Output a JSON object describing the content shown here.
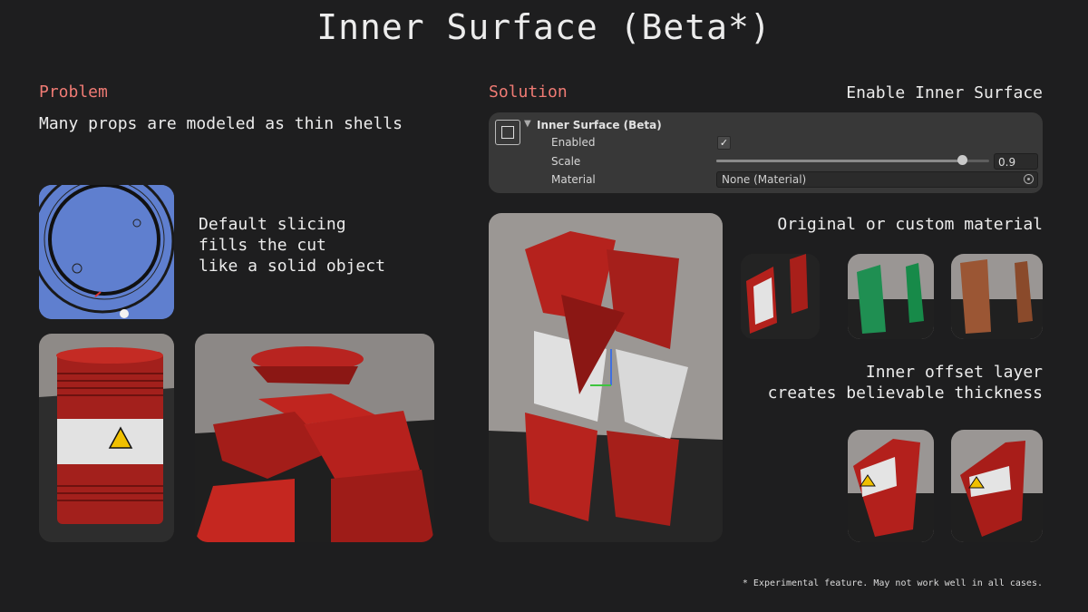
{
  "title": "Inner Surface (Beta*)",
  "problem": {
    "label": "Problem",
    "subtitle": "Many props are modeled as thin shells",
    "default_slicing": "Default slicing\nfills the cut\nlike a solid object"
  },
  "solution": {
    "label": "Solution",
    "enable_caption": "Enable Inner Surface",
    "material_caption": "Original or custom material",
    "offset_caption": "Inner offset layer\ncreates believable thickness"
  },
  "inspector": {
    "header": "Inner Surface (Beta)",
    "enabled_label": "Enabled",
    "enabled_check": "✓",
    "enabled": true,
    "scale_label": "Scale",
    "scale_value": "0.9",
    "scale_fraction": 0.9,
    "material_label": "Material",
    "material_value": "None (Material)"
  },
  "footnote": "* Experimental feature. May not work well in all cases.",
  "colors": {
    "accent": "#f07b74",
    "background": "#1e1e1f",
    "barrel_red": "#b3201c"
  }
}
